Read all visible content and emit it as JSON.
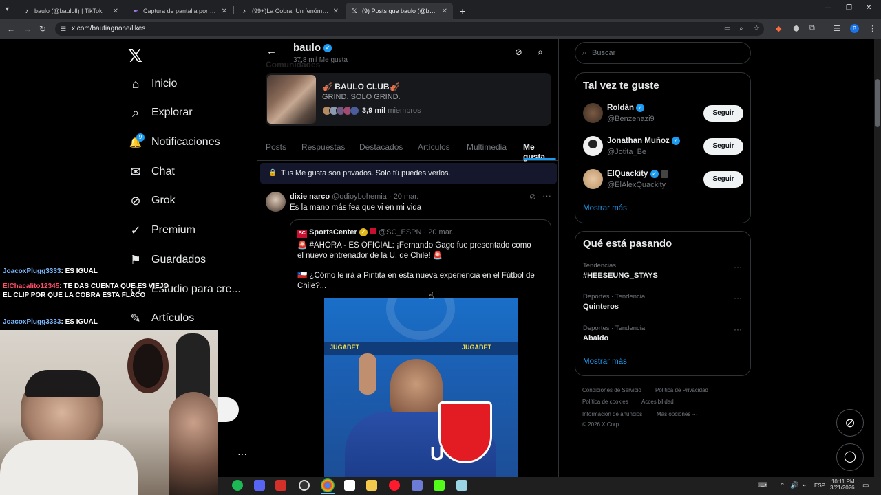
{
  "browser": {
    "tabs": [
      {
        "label": "baulo (@bauloll) | TikTok",
        "icon": "tiktok-icon",
        "active": false
      },
      {
        "label": "Captura de pantalla por Lightshot",
        "icon": "lightshot-icon",
        "active": false
      },
      {
        "label": "(99+)La Cobra: Un fenómeno en",
        "icon": "tiktok-icon",
        "active": false
      },
      {
        "label": "(9) Posts que baulo (@bautiagn",
        "icon": "x-icon",
        "active": true
      }
    ],
    "new_tab": "+",
    "url": "x.com/bautiagnone/likes"
  },
  "nav": {
    "logo": "𝕏",
    "items": [
      {
        "label": "Inicio",
        "icon": "home-icon",
        "glyph": "⌂"
      },
      {
        "label": "Explorar",
        "icon": "search-icon",
        "glyph": "⌕"
      },
      {
        "label": "Notificaciones",
        "icon": "bell-icon",
        "glyph": "🔔",
        "badge": "9"
      },
      {
        "label": "Chat",
        "icon": "mail-icon",
        "glyph": "✉"
      },
      {
        "label": "Grok",
        "icon": "grok-icon",
        "glyph": "⊘"
      },
      {
        "label": "Premium",
        "icon": "premium-icon",
        "glyph": "✓"
      },
      {
        "label": "Guardados",
        "icon": "bookmark-icon",
        "glyph": "⚑"
      },
      {
        "label": "Estudio para cre...",
        "icon": "studio-icon",
        "glyph": "◇"
      },
      {
        "label": "Artículos",
        "icon": "articles-icon",
        "glyph": "✎"
      }
    ]
  },
  "profile": {
    "name": "baulo",
    "likes_count": "37,8 mil Me gusta",
    "communities_heading": "Comunidades",
    "community": {
      "name": "🎻 BAULO CLUB🎻",
      "tagline": "GRIND. SOLO GRIND.",
      "members_count": "3,9 mil",
      "members_label": "miembros"
    }
  },
  "profile_tabs": [
    "Posts",
    "Respuestas",
    "Destacados",
    "Artículos",
    "Multimedia",
    "Me gusta"
  ],
  "active_tab": "Me gusta",
  "privacy_notice": "Tus Me gusta son privados. Solo tú puedes verlos.",
  "post": {
    "author": "dixie narco",
    "handle": "@odioybohemia",
    "date": "· 20 mar.",
    "text": "Es la mano más fea que vi en mi vida",
    "quoted": {
      "author": "SportsCenter",
      "handle": "@SC_ESPN",
      "date": "· 20 mar.",
      "line1": "🚨 #AHORA - ES OFICIAL: ¡Fernando Gago fue presentado como el nuevo entrenador de la U. de Chile! 🚨",
      "line2": "🇨🇱 ¿Cómo le irá a Pintita en esta nueva experiencia en el Fútbol de Chile?...",
      "image_sponsor": "JUGABET"
    }
  },
  "right": {
    "search_placeholder": "Buscar",
    "suggestions_title": "Tal vez te guste",
    "suggestions": [
      {
        "name": "Roldán",
        "handle": "@Benzenazi9",
        "button": "Seguir"
      },
      {
        "name": "Jonathan Muñoz",
        "handle": "@Jotita_Be",
        "button": "Seguir"
      },
      {
        "name": "ElQuackity",
        "handle": "@ElAlexQuackity",
        "button": "Seguir"
      }
    ],
    "show_more": "Mostrar más",
    "trends_title": "Qué está pasando",
    "trends": [
      {
        "context": "Tendencias",
        "topic": "#HEESEUNG_STAYS"
      },
      {
        "context": "Deportes · Tendencia",
        "topic": "Quinteros"
      },
      {
        "context": "Deportes · Tendencia",
        "topic": "Abaldo"
      }
    ],
    "trends_more": "Mostrar más",
    "footer": [
      "Condiciones de Servicio",
      "Política de Privacidad",
      "Política de cookies",
      "Accesibilidad",
      "Información de anuncios",
      "Más opciones ···",
      "© 2026 X Corp."
    ]
  },
  "chat_overlay": [
    {
      "user": "JoacoxPlugg3333",
      "message": ": ES IGUAL",
      "color": "#7ab8ff"
    },
    {
      "user": "ElChacalito12345",
      "message": ": TE DAS CUENTA QUE ES VIEJO EL CLIP POR QUE LA COBRA ESTA FLACO",
      "color": "#ff4d6a"
    },
    {
      "user": "JoacoxPlugg3333",
      "message": ": ES IGUAL",
      "color": "#7ab8ff"
    }
  ],
  "taskbar": {
    "lang": "ESP",
    "time": "10:11 PM",
    "date": "3/21/2026"
  }
}
